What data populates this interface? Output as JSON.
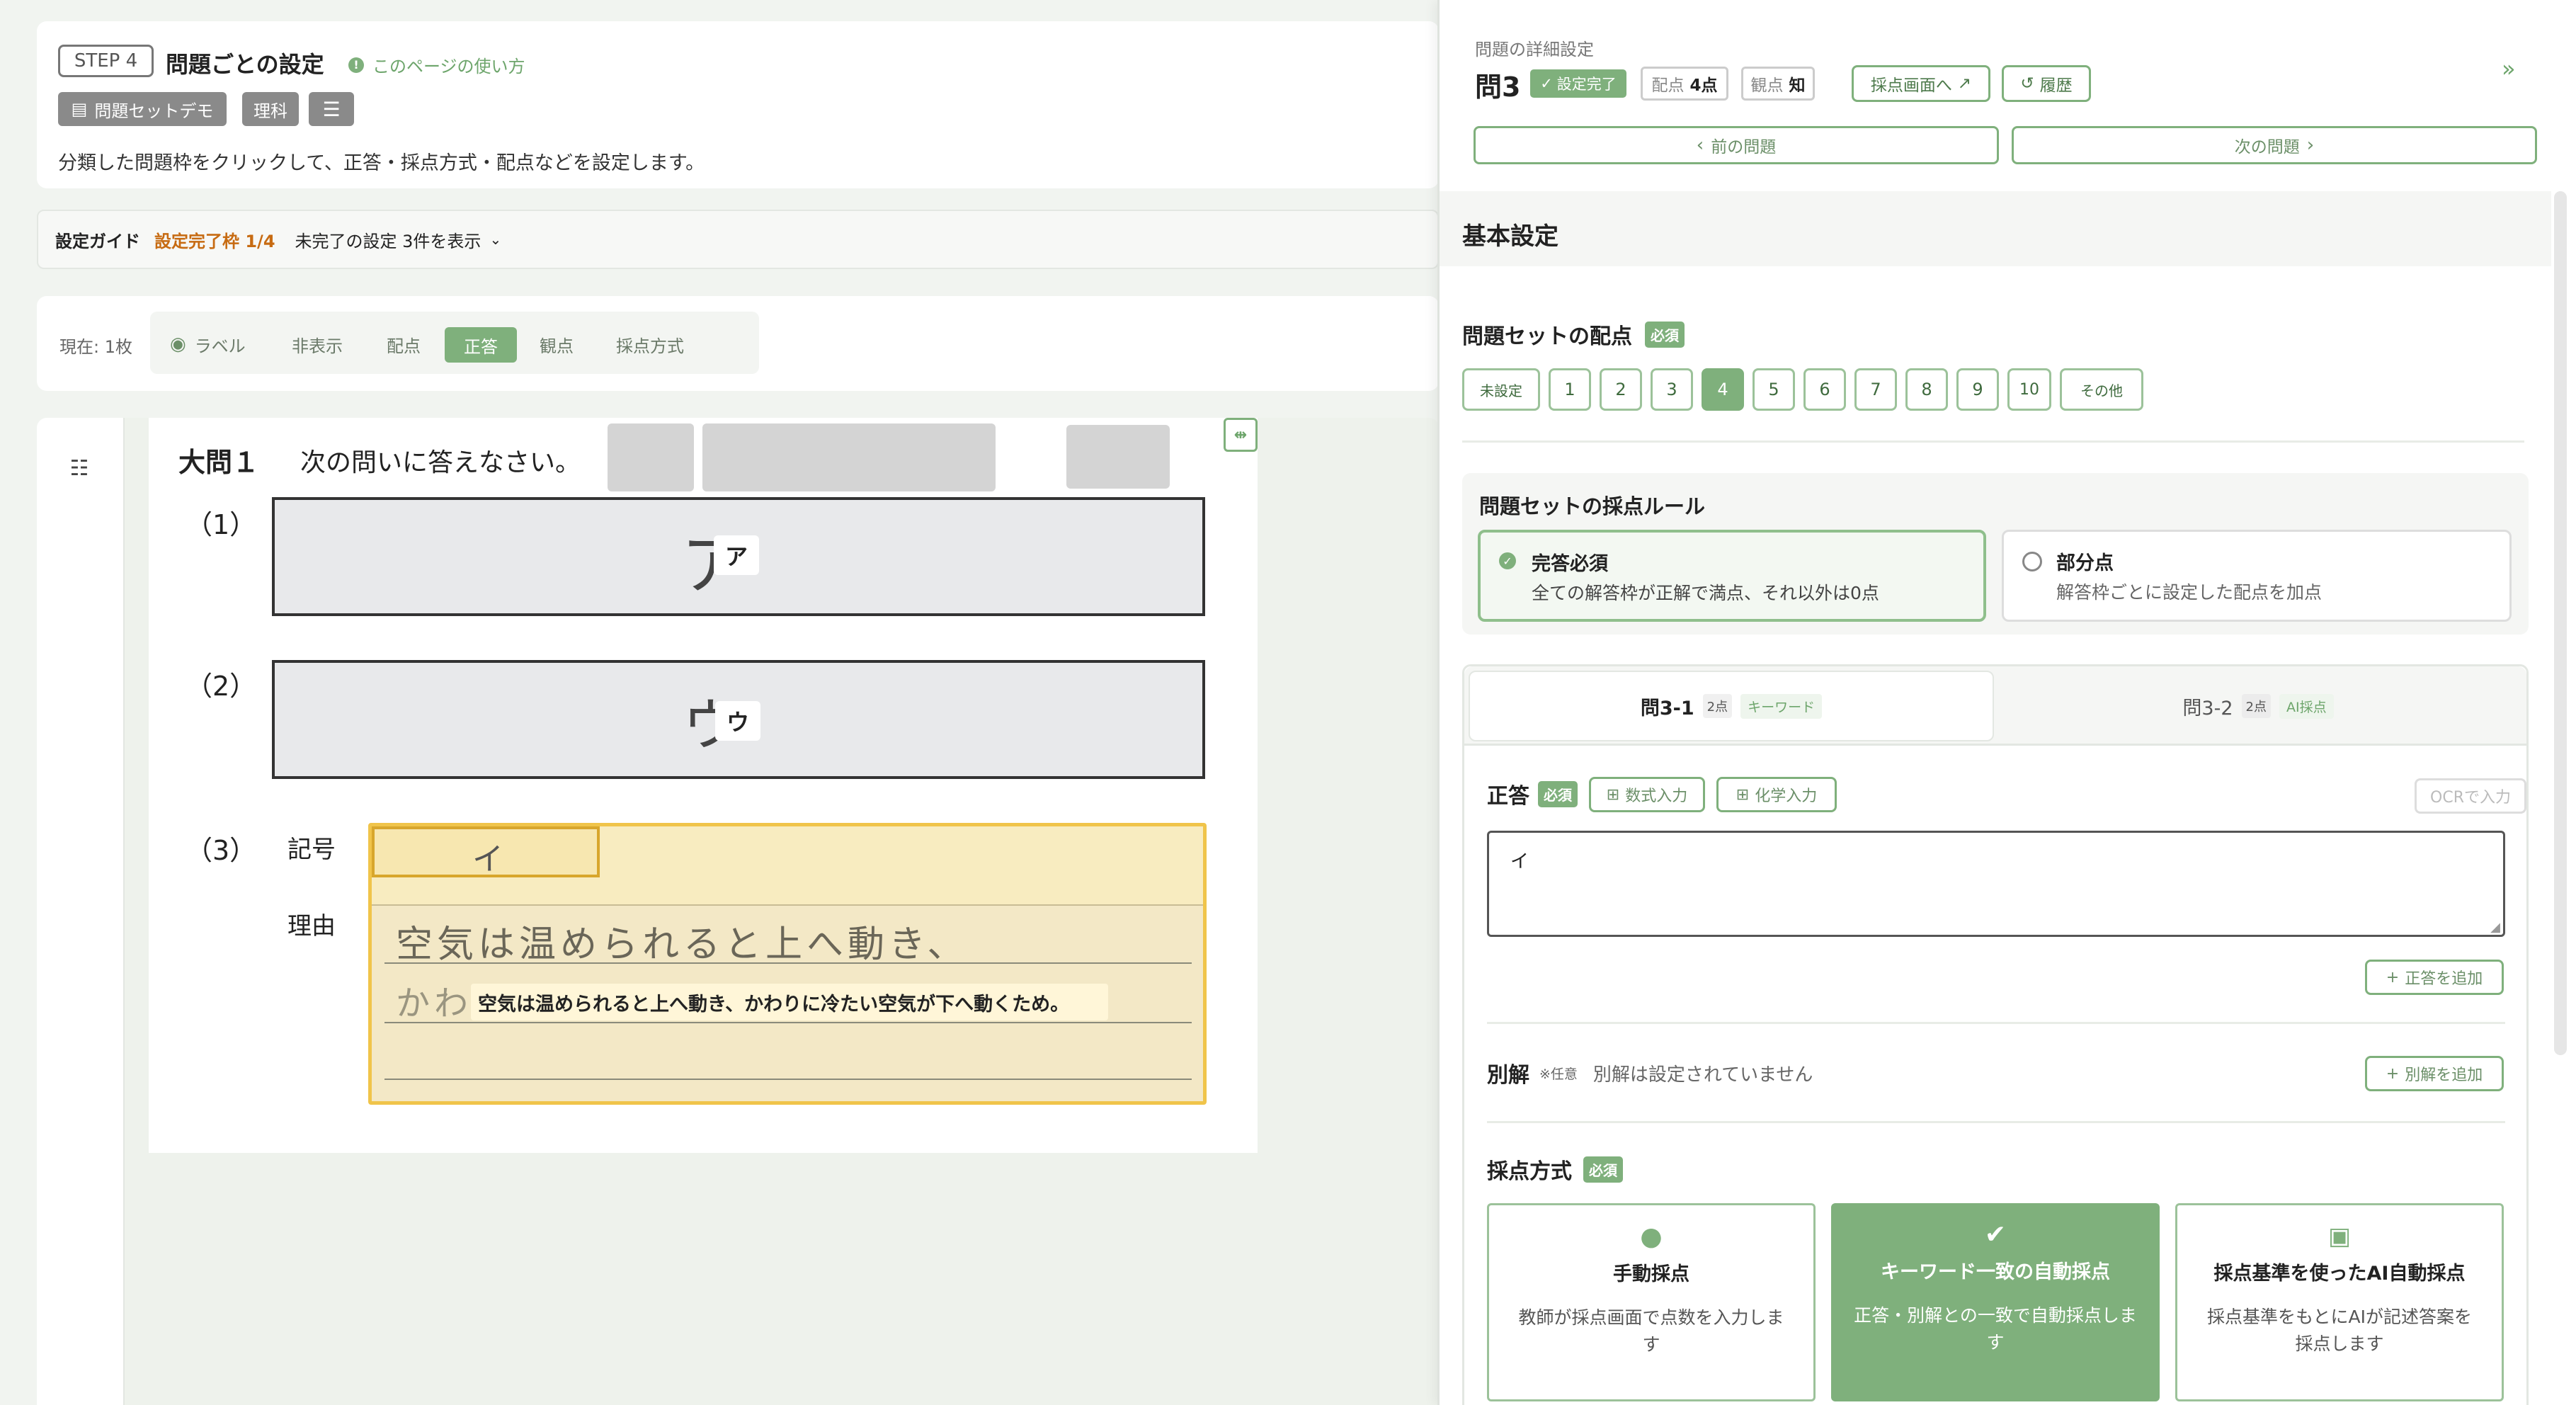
{
  "header": {
    "step": "STEP 4",
    "title": "問題ごとの設定",
    "help_link": "このページの使い方",
    "set_tag": "問題セットデモ",
    "subject_tag": "理科",
    "description": "分類した問題枠をクリックして、正答・採点方式・配点などを設定します。"
  },
  "guide": {
    "label": "設定ガイド",
    "progress": "設定完了枠 1/4",
    "incomplete": "未完了の設定 3件を表示"
  },
  "toolbar": {
    "current": "現在: 1枚",
    "tabs": [
      "ラベル",
      "非表示",
      "配点",
      "正答",
      "観点",
      "採点方式"
    ],
    "active": "正答"
  },
  "sheet": {
    "big_q": "大問１",
    "instruction": "次の問いに答えなさい。",
    "q1_label": "（1）",
    "q1_hand": "ア",
    "q1_chip": "ア",
    "q2_label": "（2）",
    "q2_hand": "ウ",
    "q2_chip": "ウ",
    "q3_label": "（3）",
    "q3_symbol_label": "記号",
    "q3_symbol_hand": "イ",
    "q3_reason_label": "理由",
    "q3_hand_line1": "空気は温められると上へ動き、",
    "q3_hand_line2": "かわりに冷たい空気が下へ動くため。",
    "q3_chip": "空気は温められると上へ動き、かわりに冷たい空気が下へ動くため。"
  },
  "panel": {
    "heading": "問題の詳細設定",
    "question": "問3",
    "status": "設定完了",
    "points_label": "配点",
    "points_value": "4点",
    "viewpoint_label": "観点",
    "viewpoint_value": "知",
    "grading_link": "採点画面へ",
    "history": "履歴",
    "prev": "前の問題",
    "next": "次の問題",
    "basic_title": "基本設定",
    "set_points_title": "問題セットの配点",
    "required": "必須",
    "optional": "※任意",
    "point_options": [
      "未設定",
      "1",
      "2",
      "3",
      "4",
      "5",
      "6",
      "7",
      "8",
      "9",
      "10",
      "その他"
    ],
    "point_selected": "4",
    "rule_title": "問題セットの採点ルール",
    "rule_all_title": "完答必須",
    "rule_all_desc": "全ての解答枠が正解で満点、それ以外は0点",
    "rule_partial_title": "部分点",
    "rule_partial_desc": "解答枠ごとに設定した配点を加点",
    "subtabs": [
      {
        "name": "問3-1",
        "points": "2点",
        "mode": "キーワード"
      },
      {
        "name": "問3-2",
        "points": "2点",
        "mode": "AI採点"
      }
    ],
    "answer_title": "正答",
    "formula_btn": "数式入力",
    "chem_btn": "化学入力",
    "ocr_btn": "OCRで入力",
    "answer_value": "イ",
    "add_answer": "正答を追加",
    "alt_title": "別解",
    "alt_none": "別解は設定されていません",
    "add_alt": "別解を追加",
    "method_title": "採点方式",
    "methods": [
      {
        "title": "手動採点",
        "desc": "教師が採点画面で点数を入力します"
      },
      {
        "title": "キーワード一致の自動採点",
        "desc": "正答・別解との一致で自動採点します"
      },
      {
        "title": "採点基準を使ったAI自動採点",
        "desc": "採点基準をもとにAIが記述答案を採点します"
      }
    ]
  },
  "colors": {
    "accent": "#7fb07c",
    "warning": "#c76b12",
    "highlight": "#f7e7b0"
  }
}
